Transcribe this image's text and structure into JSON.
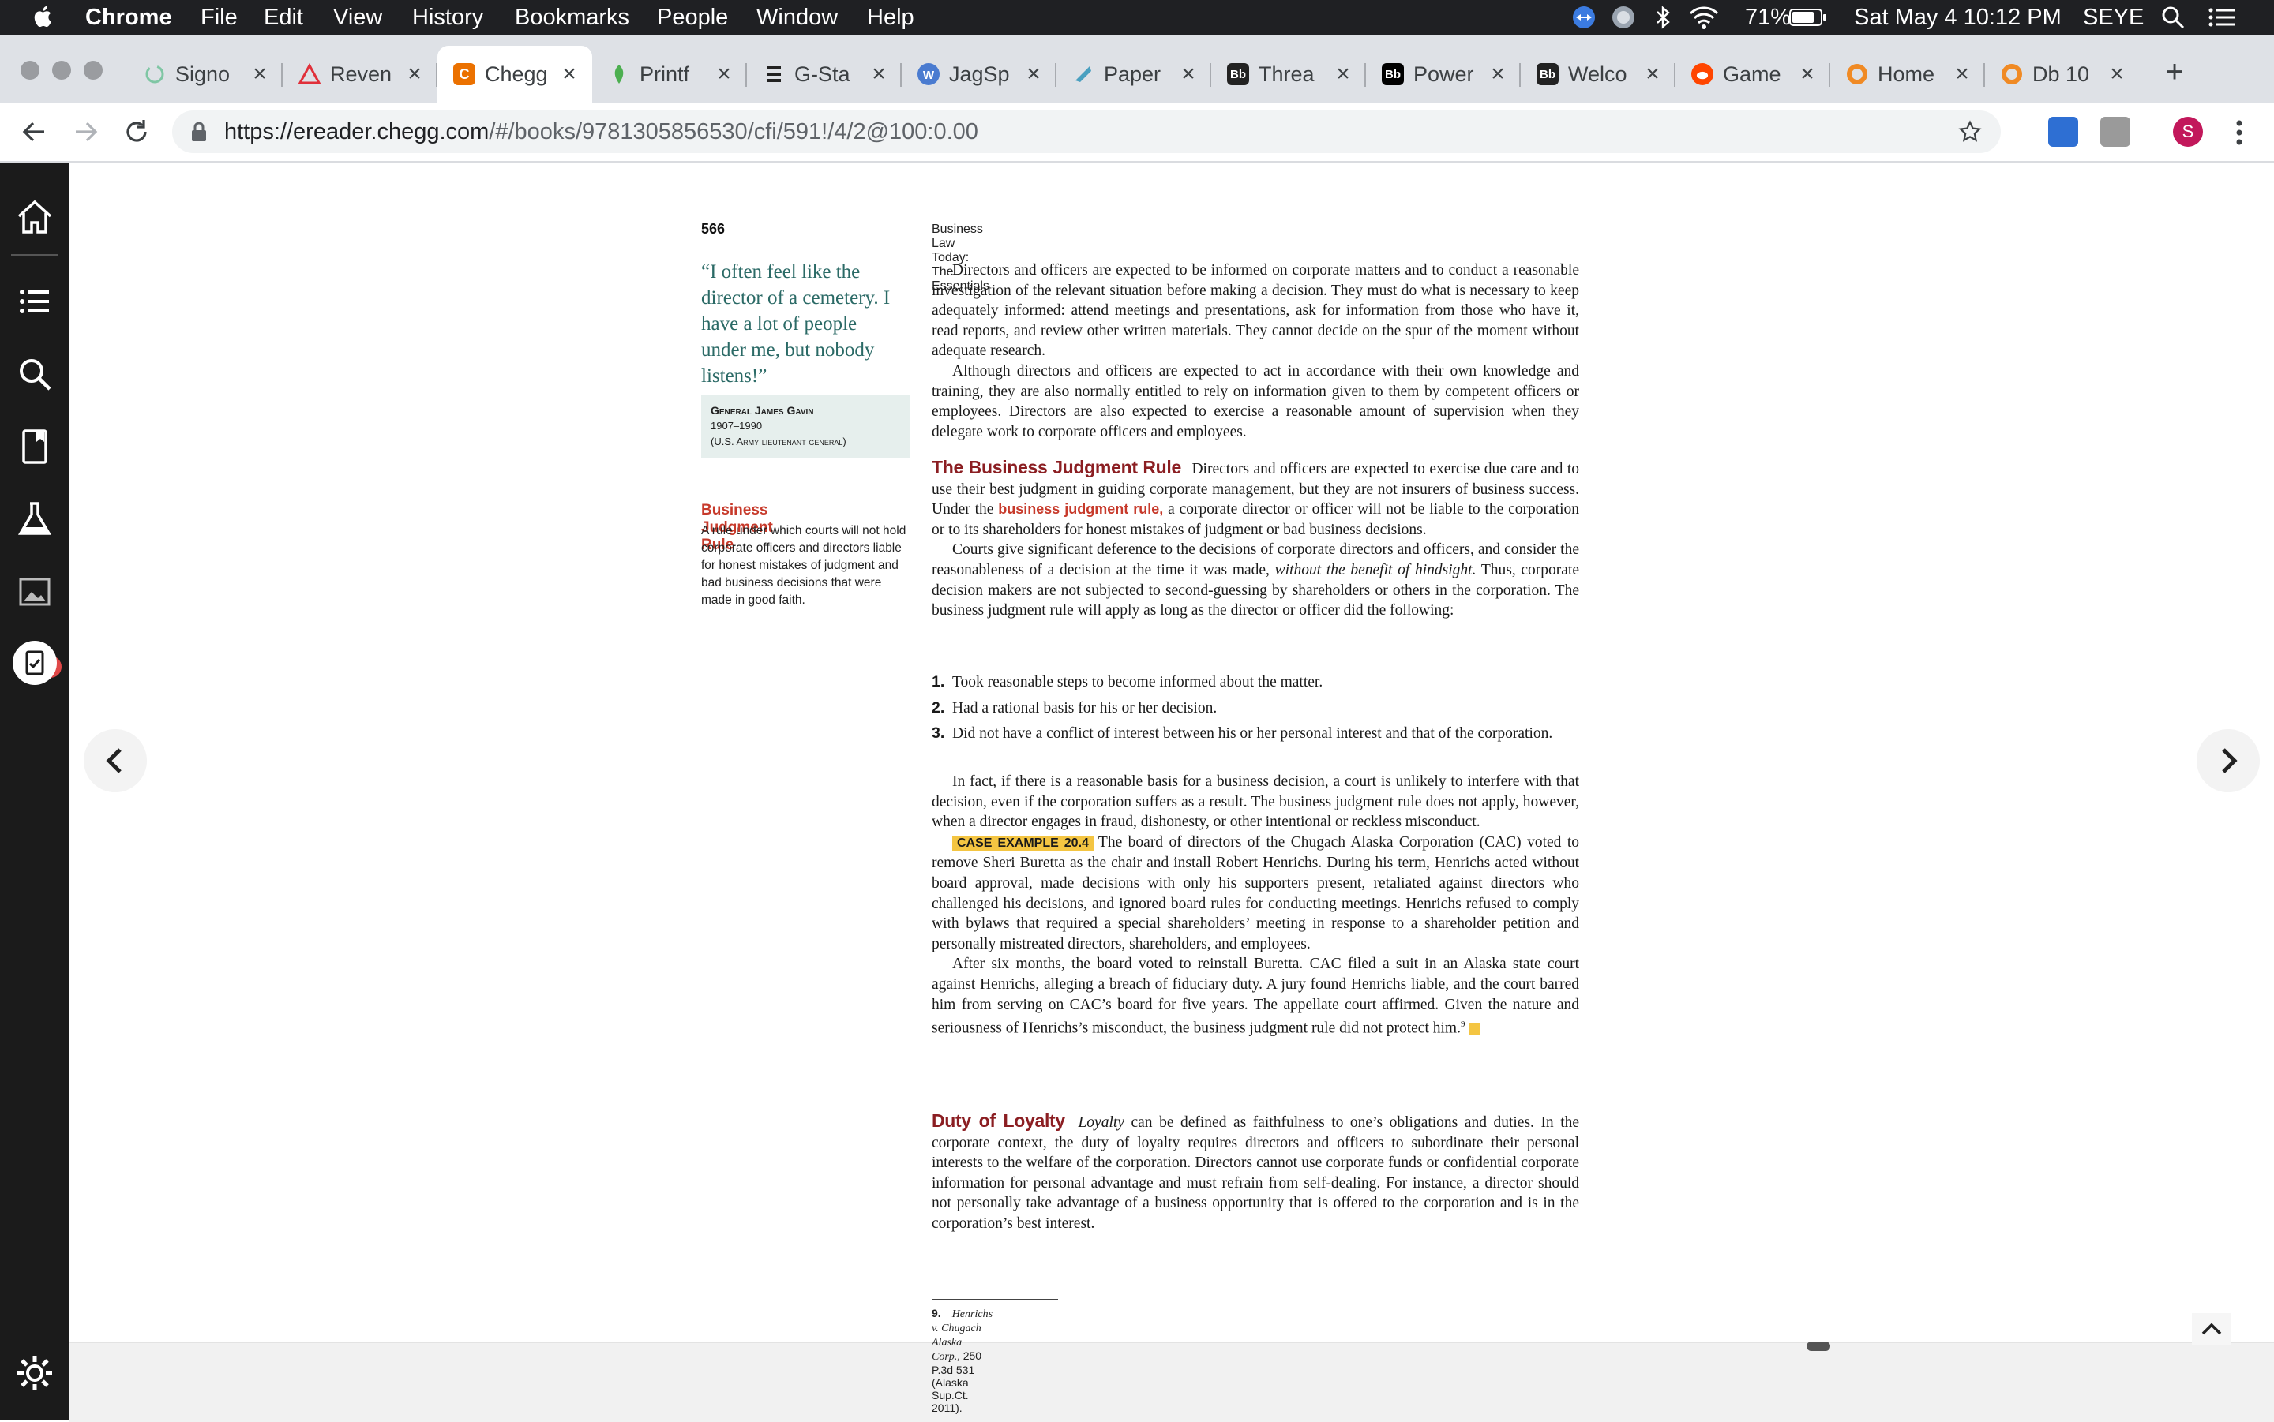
{
  "menubar": {
    "app": "Chrome",
    "items": [
      "File",
      "Edit",
      "View",
      "History",
      "Bookmarks",
      "People",
      "Window",
      "Help"
    ],
    "battery": "71%",
    "datetime": "Sat May 4  10:12 PM",
    "user": "SEYE"
  },
  "tabs": [
    {
      "title": "Signo",
      "icon": "signo-favicon",
      "color": "#7fc6a4"
    },
    {
      "title": "Reven",
      "icon": "warning-triangle-favicon",
      "color": "#e0303a"
    },
    {
      "title": "Chegg",
      "icon": "chegg-favicon",
      "color": "#eb7100"
    },
    {
      "title": "Printf",
      "icon": "printf-favicon",
      "color": "#4caf50"
    },
    {
      "title": "G-Sta",
      "icon": "g-star-favicon",
      "color": "#222222"
    },
    {
      "title": "JagSp",
      "icon": "jagsp-favicon",
      "color": "#4a7bd0"
    },
    {
      "title": "Paper",
      "icon": "paper-favicon",
      "color": "#4aa0c0"
    },
    {
      "title": "Threa",
      "icon": "bb-favicon",
      "color": "#222222"
    },
    {
      "title": "Power",
      "icon": "bb-favicon",
      "color": "#000000"
    },
    {
      "title": "Welco",
      "icon": "bb-favicon",
      "color": "#222222"
    },
    {
      "title": "Game",
      "icon": "reddit-favicon",
      "color": "#ff4500"
    },
    {
      "title": "Home",
      "icon": "life-ring-favicon",
      "color": "#f08a24"
    },
    {
      "title": "Db 10",
      "icon": "life-ring-favicon",
      "color": "#f08a24"
    }
  ],
  "toolbar": {
    "url_host": "https://ereader.chegg.com",
    "url_path": "/#/books/9781305856530/cfi/591!/4/2@100:0.00",
    "profile_initial": "S"
  },
  "sidebar": {
    "notification_count": "1"
  },
  "page": {
    "number": "566",
    "running_head": "Business Law Today: The Essentials",
    "quote": "“I often feel like the director of a cemetery. I have a lot of people under me, but nobody listens!”",
    "quote_author": "General James Gavin",
    "quote_years": "1907–1990",
    "quote_role": "(U.S. Army lieutenant general)",
    "margin_term": "Business Judgment Rule",
    "margin_def": "A rule under which courts will not hold corporate officers and directors liable for honest mistakes of judgment and bad business decisions that were made in good faith.",
    "p1": "Directors and officers are expected to be informed on corporate matters and to conduct a reasonable investigation of the relevant situation before making a decision. They must do what is necessary to keep adequately informed: attend meetings and presentations, ask for information from those who have it, read reports, and review other written materials. They cannot decide on the spur of the moment without adequate research.",
    "p2": "Although directors and officers are expected to act in accordance with their own knowledge and training, they are also normally entitled to rely on information given to them by competent officers or employees. Directors are also expected to exercise a reasonable amount of supervision when they delegate work to corporate officers and employees.",
    "h_bjr": "The Business Judgment Rule",
    "p3a": "Directors and officers are expected to exercise due care and to use their best judgment in guiding corporate management, but they are not insurers of business success. Under the",
    "p3_term": "business judgment rule,",
    "p3b": "a corporate director or officer will not be liable to the corporation or to its shareholders for honest mistakes of judgment or bad business decisions.",
    "p4a": "Courts give significant deference to the decisions of corporate directors and officers, and consider the reasonableness of a decision at the time it was made,",
    "p4_ital": "without the benefit of hindsight.",
    "p4b": "Thus, corporate decision makers are not subjected to second-guessing by shareholders or others in the corporation. The business judgment rule will apply as long as the director or officer did the following:",
    "list": [
      {
        "n": "1.",
        "t": "Took reasonable steps to become informed about the matter."
      },
      {
        "n": "2.",
        "t": "Had a rational basis for his or her decision."
      },
      {
        "n": "3.",
        "t": "Did not have a conflict of interest between his or her personal interest and that of the corporation."
      }
    ],
    "p5": "In fact, if there is a reasonable basis for a business decision, a court is unlikely to interfere with that decision, even if the corporation suffers as a result. The business judgment rule does not apply, however, when a director engages in fraud, dishonesty, or other intentional or reckless misconduct.",
    "case_label": "CASE EXAMPLE 20.4",
    "p6": "The board of directors of the Chugach Alaska Corporation (CAC) voted to remove Sheri Buretta as the chair and install Robert Henrichs. During his term, Henrichs acted without board approval, made decisions with only his supporters present, retaliated against directors who challenged his decisions, and ignored board rules for conducting meetings. Henrichs refused to comply with bylaws that required a special shareholders’ meeting in response to a shareholder petition and personally mistreated directors, shareholders, and employees.",
    "p7": "After six months, the board voted to reinstall Buretta. CAC filed a suit in an Alaska state court against Henrichs, alleging a breach of fiduciary duty. A jury found Henrichs liable, and the court barred him from serving on CAC’s board for five years. The appellate court affirmed. Given the nature and seriousness of Henrichs’s misconduct, the business judgment rule did not protect him.",
    "p7_fn": "9",
    "h_loyalty": "Duty of Loyalty",
    "p8_ital": "Loyalty",
    "p8": "can be defined as faithfulness to one’s obligations and duties. In the corporate context, the duty of loyalty requires directors and officers to subordinate their personal interests to the welfare of the corporation. Directors cannot use corporate funds or confidential corporate information for personal advantage and must refrain from self-dealing. For instance, a director should not personally take advantage of a business opportunity that is offered to the corporation and is in the corporation’s best interest.",
    "fn_num": "9.",
    "fn_case": "Henrichs v. Chugach Alaska Corp.,",
    "fn_cite": "250 P.3d 531 (Alaska Sup.Ct. 2011)."
  }
}
